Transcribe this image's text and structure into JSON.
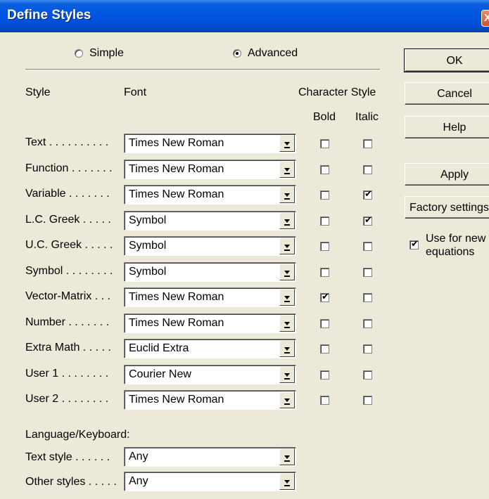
{
  "window": {
    "title": "Define Styles",
    "close_glyph": "X"
  },
  "mode": {
    "simple_label": "Simple",
    "advanced_label": "Advanced",
    "selected": "Advanced"
  },
  "headers": {
    "style": "Style",
    "font": "Font",
    "character_style": "Character Style",
    "bold": "Bold",
    "italic": "Italic"
  },
  "rows": [
    {
      "label": "Text . . . . . . . . . .",
      "font": "Times New Roman",
      "bold": false,
      "italic": false
    },
    {
      "label": "Function . . . . . . .",
      "font": "Times New Roman",
      "bold": false,
      "italic": false
    },
    {
      "label": "Variable . . . . . . .",
      "font": "Times New Roman",
      "bold": false,
      "italic": true
    },
    {
      "label": "L.C. Greek . . . . .",
      "font": "Symbol",
      "bold": false,
      "italic": true
    },
    {
      "label": "U.C. Greek . . . . .",
      "font": "Symbol",
      "bold": false,
      "italic": false
    },
    {
      "label": "Symbol . . . . . . . .",
      "font": "Symbol",
      "bold": false,
      "italic": false
    },
    {
      "label": "Vector-Matrix . . .",
      "font": "Times New Roman",
      "bold": true,
      "italic": false
    },
    {
      "label": "Number . . . . . . .",
      "font": "Times New Roman",
      "bold": false,
      "italic": false
    },
    {
      "label": "Extra Math . . . . .",
      "font": "Euclid Extra",
      "bold": false,
      "italic": false
    },
    {
      "label": "User 1 . . . . . . . .",
      "font": "Courier New",
      "bold": false,
      "italic": false
    },
    {
      "label": "User 2 . . . . . . . .",
      "font": "Times New Roman",
      "bold": false,
      "italic": false
    }
  ],
  "language": {
    "heading": "Language/Keyboard:",
    "text_style_label": "Text style . . . . . .",
    "text_style_value": "Any",
    "other_styles_label": "Other styles . . . . .",
    "other_styles_value": "Any"
  },
  "buttons": {
    "ok": "OK",
    "cancel": "Cancel",
    "help": "Help",
    "apply": "Apply",
    "factory": "Factory settings"
  },
  "use_for_new": {
    "line1": "Use for new",
    "line2": "equations",
    "checked": true
  },
  "check_glyph": "✔"
}
